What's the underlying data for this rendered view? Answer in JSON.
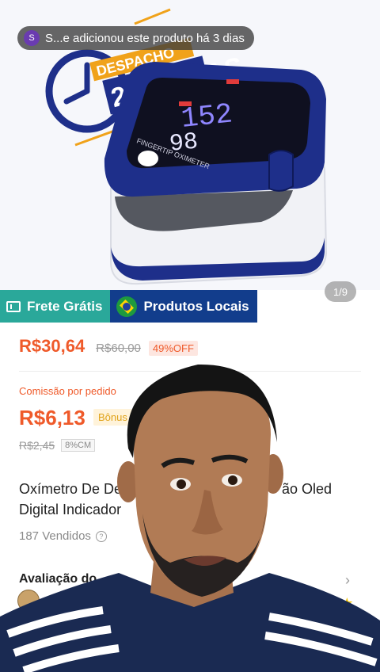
{
  "notification": {
    "avatar_letter": "S",
    "text": "S...e adicionou este produto há 3 dias"
  },
  "image_counter": "1/9",
  "product_image_text": {
    "badge_top": "DESPACHO",
    "badge_main": "24 HORAS",
    "device_label": "FINGERTIP OXIMETER"
  },
  "badges": {
    "free_shipping": "Frete Grátis",
    "local_products": "Produtos Locais"
  },
  "price": {
    "current": "R$30,64",
    "original": "R$60,00",
    "discount": "49%OFF"
  },
  "commission": {
    "label": "Comissão por pedido",
    "value": "R$6,13",
    "bonus": "Bônus",
    "old_value": "R$2,45",
    "rate": "8%CM"
  },
  "title": {
    "line1_left": "Oxímetro De De",
    "line1_right": "ão Oled",
    "line2": "Digital Indicador"
  },
  "sold": "187 Vendidos",
  "rating": {
    "title": "Avaliação do"
  },
  "colors": {
    "accent": "#ef5a2a",
    "free_badge": "#2aa89a",
    "local_badge": "#123d8c",
    "device_navy": "#1e2f8a"
  },
  "icons": [
    "free-shipping-icon",
    "brazil-flag-icon",
    "help-icon",
    "chevron-right-icon",
    "star-icon"
  ]
}
